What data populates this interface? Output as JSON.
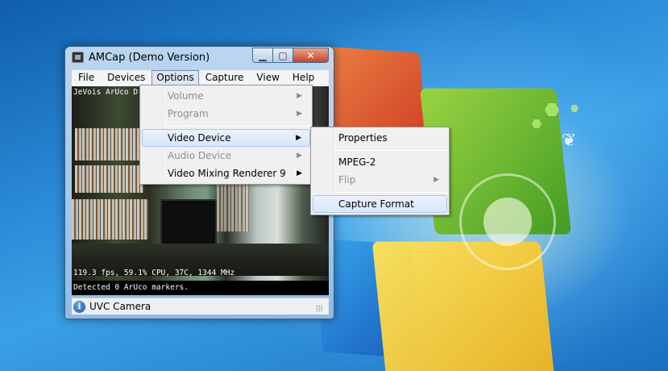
{
  "window": {
    "title": "AMCap (Demo Version)",
    "menubar": [
      "File",
      "Devices",
      "Options",
      "Capture",
      "View",
      "Help"
    ],
    "active_menu": "Options",
    "video": {
      "overlay_title": "JeVois ArUco D",
      "overlay_stats": "119.3 fps, 59.1% CPU, 37C, 1344 MHz",
      "overlay_status": "Detected 0 ArUco markers."
    },
    "statusbar": {
      "text": "UVC Camera"
    }
  },
  "options_menu": {
    "items": [
      {
        "label": "Volume",
        "enabled": false,
        "submenu": true
      },
      {
        "label": "Program",
        "enabled": false,
        "submenu": true
      },
      {
        "label": "Video Device",
        "enabled": true,
        "submenu": true,
        "highlighted": true
      },
      {
        "label": "Audio Device",
        "enabled": false,
        "submenu": true
      },
      {
        "label": "Video Mixing Renderer 9",
        "enabled": true,
        "submenu": true
      }
    ]
  },
  "video_device_submenu": {
    "items": [
      {
        "label": "Properties",
        "enabled": true
      },
      {
        "label": "MPEG-2",
        "enabled": true
      },
      {
        "label": "Flip",
        "enabled": false,
        "submenu": true
      },
      {
        "label": "Capture Format",
        "enabled": true,
        "highlighted": true
      }
    ]
  },
  "icons": {
    "app": "webcam-icon",
    "info": "info-icon",
    "submenu_arrow": "▶"
  },
  "colors": {
    "menu_bg": "#f0f0f0",
    "highlight": "#d8e7f9",
    "disabled_text": "#8d8d8d",
    "close_button": "#c4442a"
  }
}
